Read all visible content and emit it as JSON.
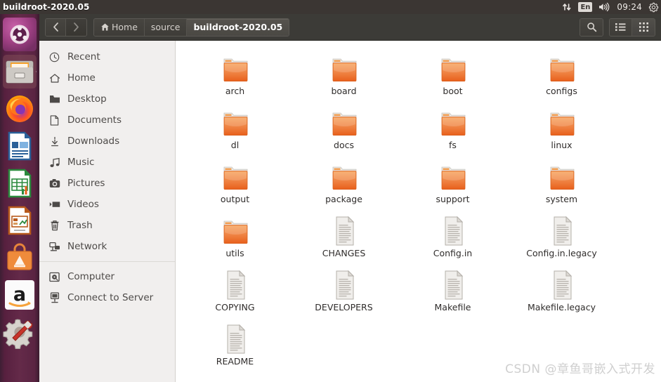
{
  "topbar": {
    "window_title": "buildroot-2020.05",
    "indicators": [
      {
        "name": "network-indicator",
        "icon": "network-updown-icon"
      },
      {
        "name": "keyboard-indicator",
        "icon": "keyboard-layout-icon",
        "label": "En"
      },
      {
        "name": "volume-indicator",
        "icon": "speaker-icon"
      },
      {
        "name": "clock-indicator",
        "icon": "clock-icon",
        "label": "09:24"
      },
      {
        "name": "session-indicator",
        "icon": "gear-icon"
      }
    ],
    "clock": "09:24",
    "keyboard_layout": "En"
  },
  "launcher": {
    "items": [
      {
        "label": "Ubuntu Dash",
        "icon": "ubuntu-logo-icon"
      },
      {
        "label": "Files",
        "icon": "file-cabinet-icon",
        "running": true
      },
      {
        "label": "Firefox",
        "icon": "firefox-icon"
      },
      {
        "label": "LibreOffice Writer",
        "icon": "libreoffice-writer-icon"
      },
      {
        "label": "LibreOffice Calc",
        "icon": "libreoffice-calc-icon"
      },
      {
        "label": "LibreOffice Impress",
        "icon": "libreoffice-impress-icon"
      },
      {
        "label": "Ubuntu Software",
        "icon": "ubuntu-software-icon"
      },
      {
        "label": "Amazon",
        "icon": "amazon-icon"
      },
      {
        "label": "System Settings",
        "icon": "gear-wrench-icon"
      }
    ]
  },
  "header": {
    "back_label": "‹",
    "forward_label": "›",
    "breadcrumbs": [
      {
        "label": "Home",
        "icon": "home-icon",
        "active": false
      },
      {
        "label": "source",
        "icon": "",
        "active": false
      },
      {
        "label": "buildroot-2020.05",
        "icon": "",
        "active": true
      }
    ],
    "search_icon": "search-icon",
    "list_view_icon": "list-view-icon",
    "grid_view_icon": "grid-view-icon"
  },
  "places": {
    "groups": [
      [
        {
          "label": "Recent",
          "icon": "clock-icon"
        },
        {
          "label": "Home",
          "icon": "home-icon"
        },
        {
          "label": "Desktop",
          "icon": "folder-icon"
        },
        {
          "label": "Documents",
          "icon": "document-icon"
        },
        {
          "label": "Downloads",
          "icon": "download-arrow-icon"
        },
        {
          "label": "Music",
          "icon": "music-note-icon"
        },
        {
          "label": "Pictures",
          "icon": "camera-icon"
        },
        {
          "label": "Videos",
          "icon": "video-icon"
        },
        {
          "label": "Trash",
          "icon": "trash-icon"
        },
        {
          "label": "Network",
          "icon": "network-icon"
        }
      ],
      [
        {
          "label": "Computer",
          "icon": "harddisk-icon"
        },
        {
          "label": "Connect to Server",
          "icon": "server-icon"
        }
      ]
    ]
  },
  "files": {
    "items": [
      {
        "name": "arch",
        "type": "folder"
      },
      {
        "name": "board",
        "type": "folder"
      },
      {
        "name": "boot",
        "type": "folder"
      },
      {
        "name": "configs",
        "type": "folder"
      },
      {
        "name": "dl",
        "type": "folder"
      },
      {
        "name": "docs",
        "type": "folder"
      },
      {
        "name": "fs",
        "type": "folder"
      },
      {
        "name": "linux",
        "type": "folder"
      },
      {
        "name": "output",
        "type": "folder"
      },
      {
        "name": "package",
        "type": "folder"
      },
      {
        "name": "support",
        "type": "folder"
      },
      {
        "name": "system",
        "type": "folder"
      },
      {
        "name": "utils",
        "type": "folder"
      },
      {
        "name": "CHANGES",
        "type": "file"
      },
      {
        "name": "Config.in",
        "type": "file"
      },
      {
        "name": "Config.in.legacy",
        "type": "file"
      },
      {
        "name": "COPYING",
        "type": "file"
      },
      {
        "name": "DEVELOPERS",
        "type": "file"
      },
      {
        "name": "Makefile",
        "type": "file"
      },
      {
        "name": "Makefile.legacy",
        "type": "file"
      },
      {
        "name": "README",
        "type": "file"
      }
    ]
  },
  "watermark": {
    "text": "CSDN @章鱼哥嵌入式开发"
  },
  "colors": {
    "panel": "#3b3633",
    "launcher": "#5a2442",
    "header": "#3c3b37",
    "sidebar": "#f1efee",
    "folder_orange": "#e8601c",
    "content": "#ffffff"
  }
}
